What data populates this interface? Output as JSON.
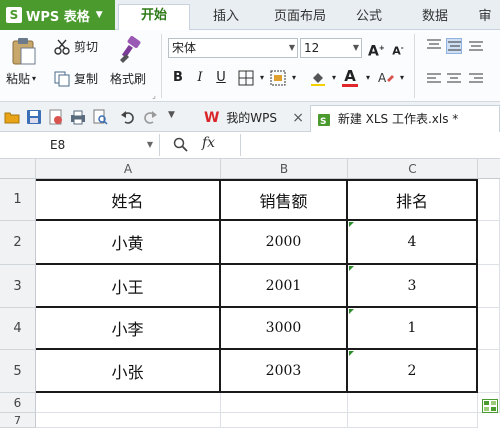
{
  "app": {
    "name": "WPS 表格",
    "logo_letter": "S"
  },
  "menu": {
    "tabs": [
      "开始",
      "插入",
      "页面布局",
      "公式",
      "数据",
      "审"
    ],
    "active": "开始"
  },
  "ribbon": {
    "paste": "粘贴",
    "cut": "剪切",
    "copy": "复制",
    "format_painter": "格式刷",
    "font_name": "宋体",
    "font_size": "12",
    "bold": "B",
    "italic": "I",
    "underline": "U"
  },
  "doc_tabs": [
    {
      "label": "我的WPS",
      "close": "×"
    },
    {
      "label": "新建 XLS 工作表.xls *"
    }
  ],
  "formula_bar": {
    "cell_ref": "E8",
    "fx": "fx",
    "content": ""
  },
  "columns": [
    "A",
    "B",
    "C"
  ],
  "rows": [
    {
      "num": "1",
      "cells": [
        "姓名",
        "销售额",
        "排名"
      ]
    },
    {
      "num": "2",
      "cells": [
        "小黄",
        "2000",
        "4"
      ]
    },
    {
      "num": "3",
      "cells": [
        "小王",
        "2001",
        "3"
      ]
    },
    {
      "num": "4",
      "cells": [
        "小李",
        "3000",
        "1"
      ]
    },
    {
      "num": "5",
      "cells": [
        "小张",
        "2003",
        "2"
      ]
    },
    {
      "num": "6",
      "cells": [
        "",
        "",
        ""
      ]
    },
    {
      "num": "7",
      "cells": [
        "",
        "",
        ""
      ]
    }
  ],
  "colors": {
    "accent": "#4a9a2e",
    "active_tab": "#2e7a19",
    "warning_triangle": "#2e8b2e",
    "font_color": "#e0262b",
    "highlight": "#f5d000"
  }
}
